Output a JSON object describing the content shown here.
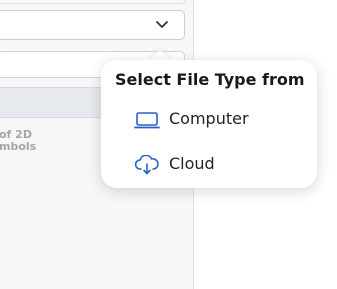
{
  "background": {
    "hint_text": "of 2D\nmbols"
  },
  "file_type_menu": {
    "title": "Select File Type from",
    "options": [
      {
        "label": "Computer",
        "icon": "laptop-icon"
      },
      {
        "label": "Cloud",
        "icon": "cloud-download-icon"
      }
    ]
  },
  "colors": {
    "icon_accent": "#2563c9",
    "panel_background": "#f7f7f7",
    "band_background": "#e6e9ee"
  }
}
